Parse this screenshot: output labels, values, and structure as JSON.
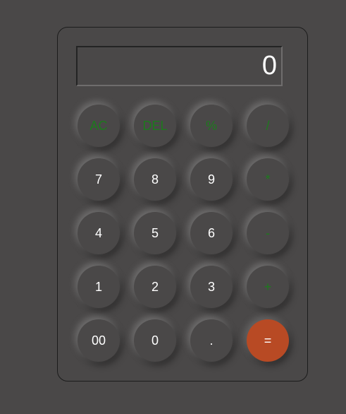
{
  "display": {
    "value": "0"
  },
  "keys": {
    "ac": "AC",
    "del": "DEL",
    "percent": "%",
    "divide": "/",
    "seven": "7",
    "eight": "8",
    "nine": "9",
    "multiply": "*",
    "four": "4",
    "five": "5",
    "six": "6",
    "minus": "-",
    "one": "1",
    "two": "2",
    "three": "3",
    "plus": "+",
    "double_zero": "00",
    "zero": "0",
    "dot": ".",
    "equals": "="
  },
  "colors": {
    "background": "#4a4848",
    "operator_text": "#1d7a1d",
    "equals_button": "#b84a24",
    "digit_text": "#ffffff"
  }
}
